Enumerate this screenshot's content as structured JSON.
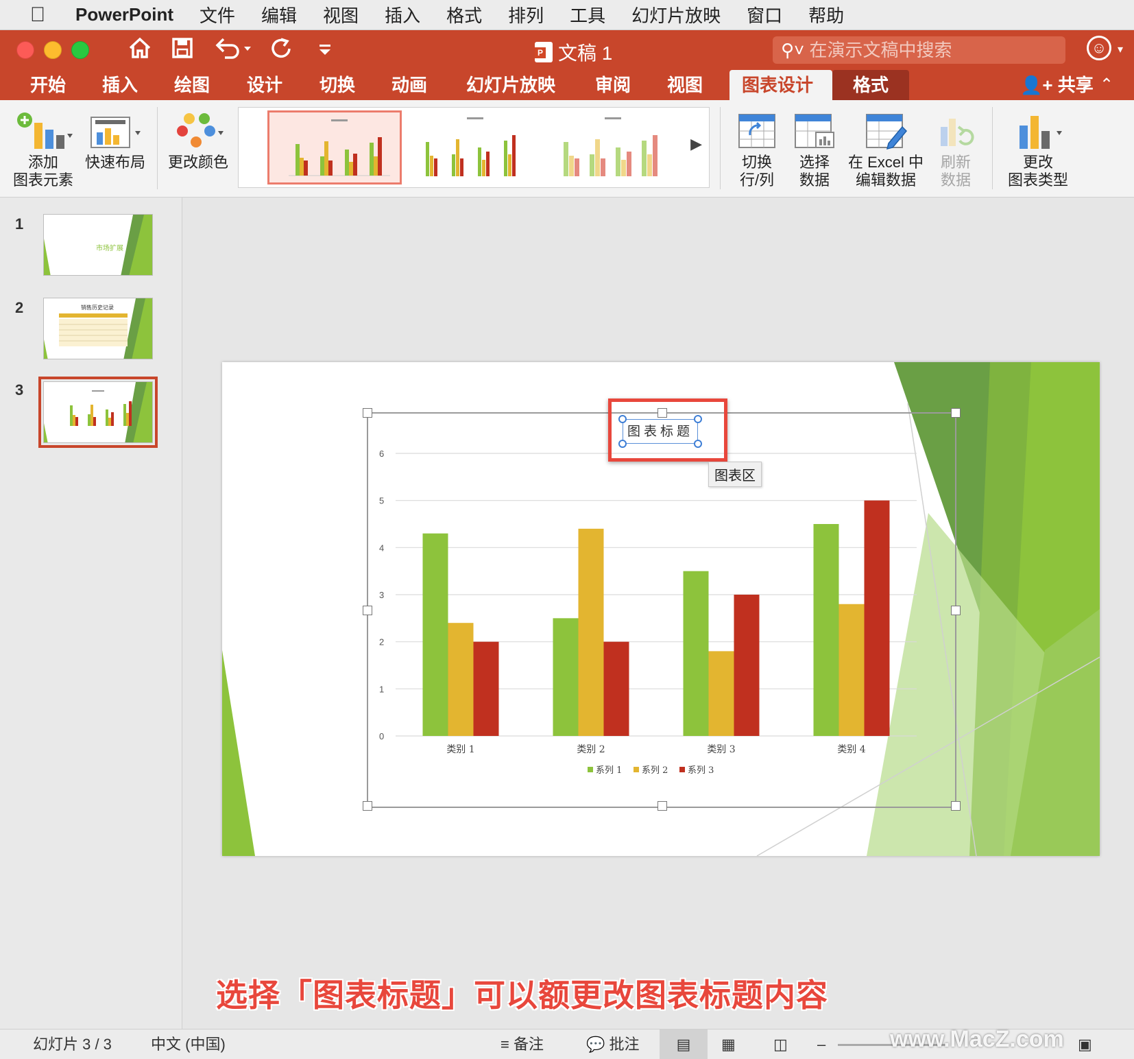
{
  "menubar": {
    "app_name": "PowerPoint",
    "items": [
      "文件",
      "编辑",
      "视图",
      "插入",
      "格式",
      "排列",
      "工具",
      "幻灯片放映",
      "窗口",
      "帮助"
    ]
  },
  "titlebar": {
    "doc_title": "文稿 1",
    "search_placeholder": "在演示文稿中搜索"
  },
  "tabs": [
    "开始",
    "插入",
    "绘图",
    "设计",
    "切换",
    "动画",
    "幻灯片放映",
    "审阅",
    "视图",
    "图表设计",
    "格式"
  ],
  "active_tab": "图表设计",
  "share_label": "共享",
  "ribbon": {
    "add_element": [
      "添加",
      "图表元素"
    ],
    "quick_layout": "快速布局",
    "change_colors": "更改颜色",
    "switch_row_col": [
      "切换",
      "行/列"
    ],
    "select_data": [
      "选择",
      "数据"
    ],
    "edit_excel": [
      "在 Excel 中",
      "编辑数据"
    ],
    "refresh_data": [
      "刷新",
      "数据"
    ],
    "change_type": [
      "更改",
      "图表类型"
    ]
  },
  "slides": {
    "numbers": [
      "1",
      "2",
      "3"
    ],
    "thumb1_title": "市场扩展",
    "thumb2_title": "销售历史记录",
    "current": 3
  },
  "chart_data": {
    "type": "bar",
    "title": "图表标题",
    "categories": [
      "类别 1",
      "类别 2",
      "类别 3",
      "类别 4"
    ],
    "series": [
      {
        "name": "系列 1",
        "values": [
          4.3,
          2.5,
          3.5,
          4.5
        ],
        "color": "#8dc33c"
      },
      {
        "name": "系列 2",
        "values": [
          2.4,
          4.4,
          1.8,
          2.8
        ],
        "color": "#e3b530"
      },
      {
        "name": "系列 3",
        "values": [
          2,
          2,
          3,
          5
        ],
        "color": "#c0301f"
      }
    ],
    "ylim": [
      0,
      6
    ],
    "yticks": [
      "0",
      "1",
      "2",
      "3",
      "4",
      "5",
      "6"
    ],
    "grid": true,
    "legend_position": "bottom"
  },
  "tooltip": "图表区",
  "caption": "选择「图表标题」可以额更改图表标题内容",
  "status": {
    "slide_info": "幻灯片 3 / 3",
    "language": "中文 (中国)",
    "notes": "备注",
    "comments": "批注"
  },
  "watermark": "www.MacZ.com",
  "colors": {
    "accent": "#c8462b",
    "highlight": "#e8473c",
    "green": "#8dc33c"
  }
}
